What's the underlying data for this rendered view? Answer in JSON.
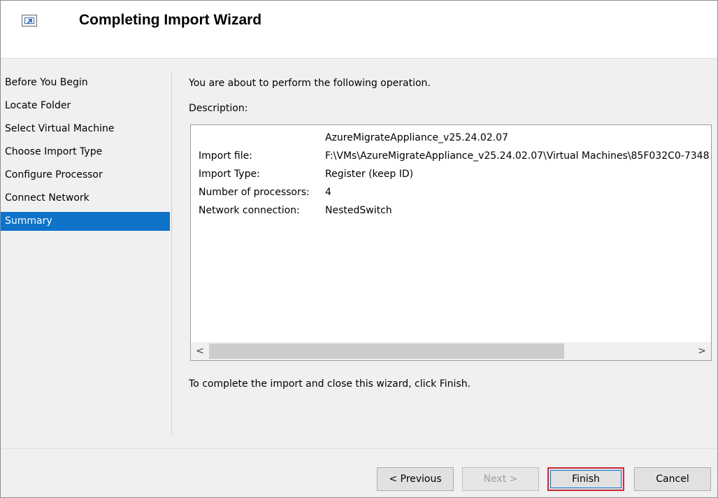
{
  "window": {
    "title": "Completing Import Wizard",
    "icon": "import-wizard-icon"
  },
  "steps": [
    {
      "label": "Before You Begin",
      "active": false
    },
    {
      "label": "Locate Folder",
      "active": false
    },
    {
      "label": "Select Virtual Machine",
      "active": false
    },
    {
      "label": "Choose Import Type",
      "active": false
    },
    {
      "label": "Configure Processor",
      "active": false
    },
    {
      "label": "Connect Network",
      "active": false
    },
    {
      "label": "Summary",
      "active": true
    }
  ],
  "main": {
    "intro": "You are about to perform the following operation.",
    "description_label": "Description:",
    "description": {
      "heading_value": "AzureMigrateAppliance_v25.24.02.07",
      "rows": [
        {
          "key": "Import file:",
          "value": "F:\\VMs\\AzureMigrateAppliance_v25.24.02.07\\Virtual Machines\\85F032C0-7348"
        },
        {
          "key": "Import Type:",
          "value": "Register (keep ID)"
        },
        {
          "key": "Number of processors:",
          "value": "4"
        },
        {
          "key": "Network connection:",
          "value": "NestedSwitch"
        }
      ]
    },
    "scroll": {
      "left_arrow": "<",
      "right_arrow": ">"
    },
    "finish_note": "To complete the import and close this wizard, click Finish."
  },
  "footer": {
    "previous_label": "< Previous",
    "next_label": "Next >",
    "finish_label": "Finish",
    "cancel_label": "Cancel"
  },
  "colors": {
    "selected_step": "#0e73c9",
    "finish_highlight": "#cc2b37"
  }
}
